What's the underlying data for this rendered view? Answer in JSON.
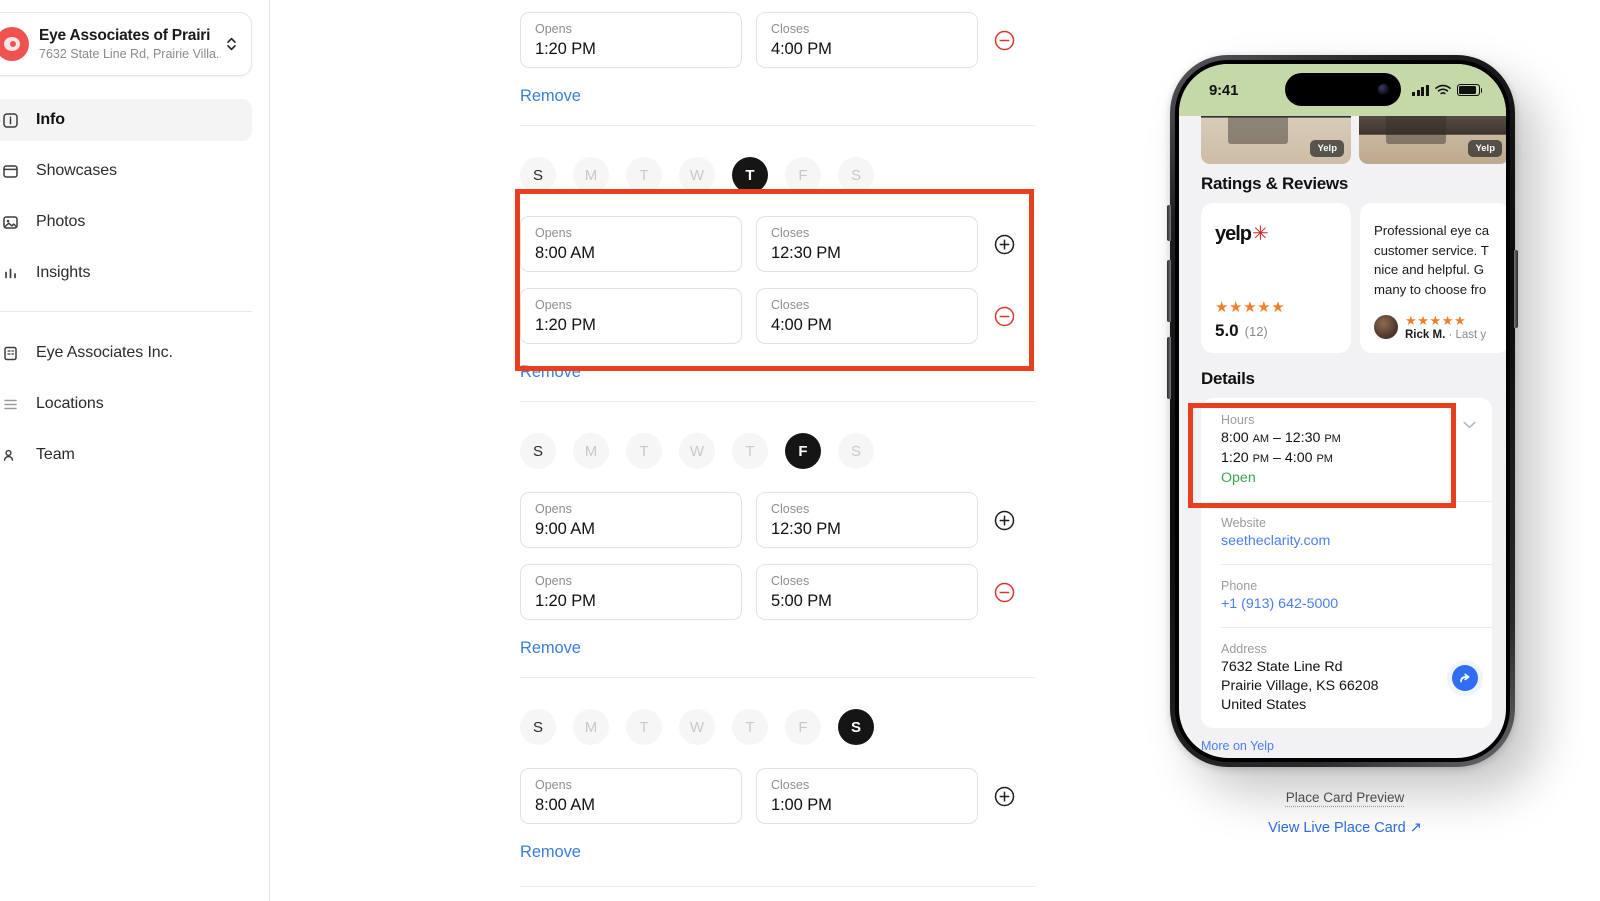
{
  "sidebar": {
    "business": {
      "name": "Eye Associates of Prairi",
      "address": "7632 State Line Rd, Prairie Villa..."
    },
    "items": [
      {
        "label": "Info",
        "icon": "info-icon",
        "active": true
      },
      {
        "label": "Showcases",
        "icon": "showcase-icon",
        "active": false
      },
      {
        "label": "Photos",
        "icon": "photos-icon",
        "active": false
      },
      {
        "label": "Insights",
        "icon": "insights-icon",
        "active": false
      }
    ],
    "items2": [
      {
        "label": "Eye Associates Inc.",
        "icon": "building-icon"
      },
      {
        "label": "Locations",
        "icon": "list-icon"
      },
      {
        "label": "Team",
        "icon": "team-icon"
      }
    ]
  },
  "form": {
    "labels": {
      "opens": "Opens",
      "closes": "Closes",
      "remove": "Remove"
    },
    "day_letters": [
      "S",
      "M",
      "T",
      "W",
      "T",
      "F",
      "S"
    ],
    "partial_top": {
      "opens": "1:20 PM",
      "closes": "4:00 PM",
      "remove": "Remove"
    },
    "groups": [
      {
        "name": "thursday-group",
        "selected_index": 4,
        "highlighted": true,
        "rows": [
          {
            "opens": "8:00 AM",
            "closes": "12:30 PM",
            "action": "add"
          },
          {
            "opens": "1:20 PM",
            "closes": "4:00 PM",
            "action": "remove"
          }
        ],
        "remove": "Remove"
      },
      {
        "name": "friday-group",
        "selected_index": 5,
        "highlighted": false,
        "rows": [
          {
            "opens": "9:00 AM",
            "closes": "12:30 PM",
            "action": "add"
          },
          {
            "opens": "1:20 PM",
            "closes": "5:00 PM",
            "action": "remove"
          }
        ],
        "remove": "Remove"
      },
      {
        "name": "saturday-group",
        "selected_index": 6,
        "highlighted": false,
        "rows": [
          {
            "opens": "8:00 AM",
            "closes": "1:00 PM",
            "action": "add"
          }
        ],
        "remove": "Remove"
      }
    ]
  },
  "preview": {
    "status": {
      "time": "9:41"
    },
    "photo_tags": [
      "Yelp",
      "Yelp"
    ],
    "ratings_title": "Ratings & Reviews",
    "yelp": {
      "brand": "yelp",
      "stars": "★★★★★",
      "score": "5.0",
      "count": "(12)"
    },
    "review": {
      "text": "Professional eye ca customer service. T nice and helpful. G many to choose fro",
      "stars": "★★★★★",
      "author": "Rick M.",
      "meta": "· Last y"
    },
    "details_title": "Details",
    "hours": {
      "label": "Hours",
      "line1_time": "8:00",
      "line1_am": "AM",
      "line1_dash": "–",
      "line1_end": "12:30",
      "line1_pm": "PM",
      "line2_time": "1:20",
      "line2_am": "PM",
      "line2_dash": "–",
      "line2_end": "4:00",
      "line2_pm": "PM",
      "status": "Open"
    },
    "website": {
      "label": "Website",
      "value": "seetheclarity.com"
    },
    "phone": {
      "label": "Phone",
      "value": "+1 (913) 642-5000"
    },
    "address": {
      "label": "Address",
      "line1": "7632 State Line Rd",
      "line2": "Prairie Village, KS 66208",
      "line3": "United States"
    },
    "more_on_yelp": "More on Yelp",
    "caption": "Place Card Preview",
    "live_link": "View Live Place Card ↗"
  },
  "colors": {
    "annotation": "#e8401f",
    "link": "#3b7ddd",
    "open": "#3fa34d",
    "brand": "#ef5350"
  }
}
